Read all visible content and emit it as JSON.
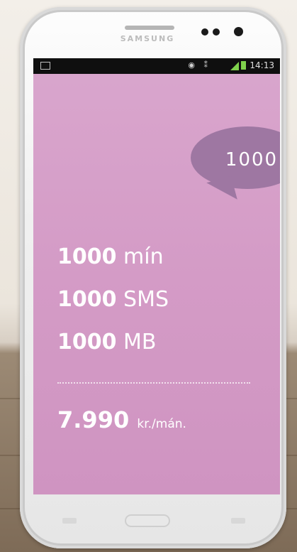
{
  "device": {
    "brand": "SAMSUNG"
  },
  "status_bar": {
    "time": "14:13",
    "notification_icon": "mail-icon",
    "right_icons": [
      "eye-icon",
      "vibrate-icon",
      "signal-icon",
      "battery-icon"
    ]
  },
  "badge": {
    "text": "1000",
    "icon": "clock-icons"
  },
  "plan": {
    "lines": [
      {
        "amount": "1000",
        "unit": "mín"
      },
      {
        "amount": "1000",
        "unit": "SMS"
      },
      {
        "amount": "1000",
        "unit": "MB"
      }
    ],
    "price": "7.990",
    "price_unit": "kr./mán."
  },
  "colors": {
    "screen": "#d49bc6",
    "bubble": "#9e77a2",
    "text": "#ffffff",
    "status_green": "#7fd14c"
  }
}
